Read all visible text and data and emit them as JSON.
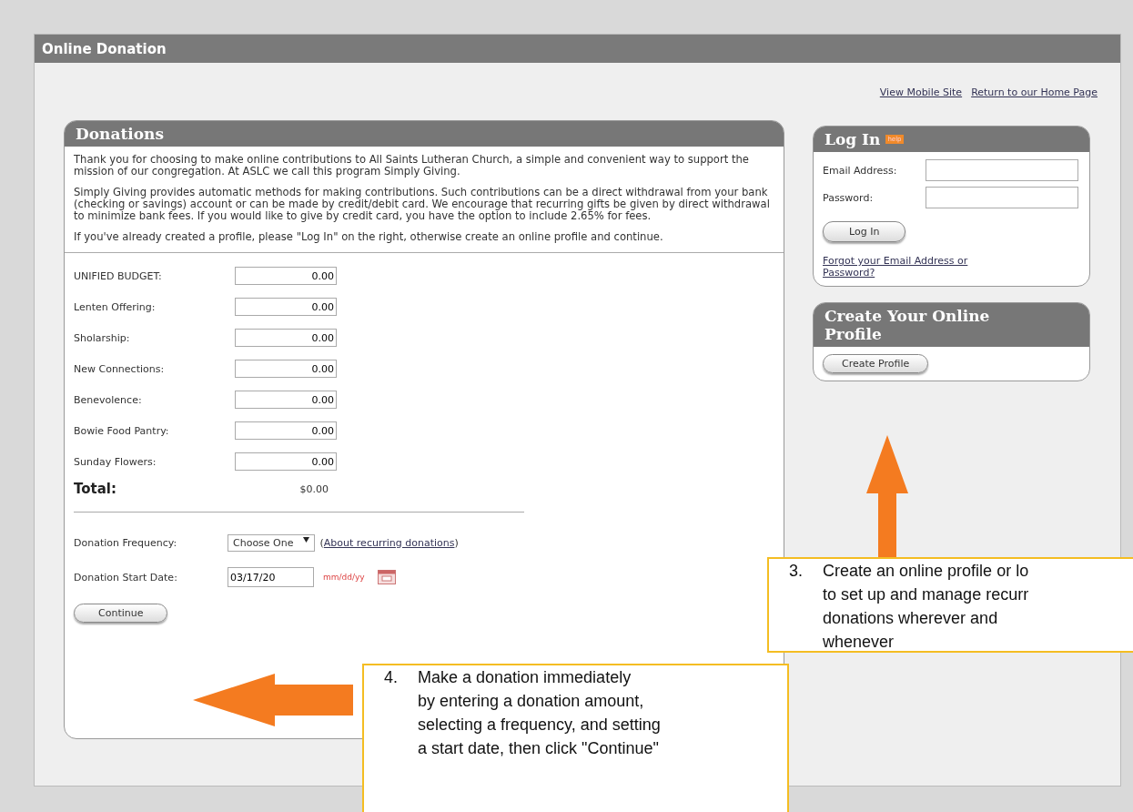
{
  "page_title": "Online Donation",
  "top_links": [
    "View Mobile Site",
    "Return to our Home Page"
  ],
  "donations": {
    "title": "Donations",
    "paragraphs": [
      "Thank you for choosing to make online contributions to All Saints Lutheran Church, a simple and convenient way to support the mission of our congregation. At ASLC we call this program Simply Giving.",
      "Simply Giving provides automatic methods for making contributions. Such contributions can be a direct withdrawal from your bank (checking or savings) account or can be made by credit/debit card. We encourage that recurring gifts be given by direct withdrawal to minimize bank fees. If you would like to give by credit card, you have the option to include 2.65% for fees.",
      "If you've already created a profile, please \"Log In\" on the right, otherwise create an online profile and continue."
    ],
    "funds": [
      {
        "label": "UNIFIED BUDGET:",
        "value": "0.00"
      },
      {
        "label": "Lenten Offering:",
        "value": "0.00"
      },
      {
        "label": "Sholarship:",
        "value": "0.00"
      },
      {
        "label": "New Connections:",
        "value": "0.00"
      },
      {
        "label": "Benevolence:",
        "value": "0.00"
      },
      {
        "label": "Bowie Food Pantry:",
        "value": "0.00"
      },
      {
        "label": "Sunday Flowers:",
        "value": "0.00"
      }
    ],
    "total": {
      "label": "Total:",
      "value": "$0.00"
    },
    "frequency": {
      "label": "Donation Frequency:",
      "value": "Choose One",
      "link_open": "(",
      "link": "About recurring donations",
      "link_close": ")"
    },
    "start_date": {
      "label": "Donation Start Date:",
      "value": "03/17/20",
      "hint": "mm/dd/yy"
    },
    "continue_button": "Continue"
  },
  "login": {
    "title": "Log In",
    "badge": "help",
    "fields": [
      {
        "label": "Email Address:"
      },
      {
        "label": "Password:"
      }
    ],
    "button": "Log In",
    "forgot_link": "Forgot your Email Address or Password?"
  },
  "create_profile": {
    "title": "Create Your Online Profile",
    "button": "Create Profile"
  },
  "callouts": [
    {
      "number": "3.",
      "lines": [
        "Create an online profile or lo",
        "to set up and manage recurr",
        "donations wherever and",
        "whenever"
      ]
    },
    {
      "number": "4.",
      "lines": [
        "Make a donation immediately",
        "by entering a donation amount,",
        "selecting a frequency, and setting",
        "a start date, then click \"Continue\""
      ]
    }
  ]
}
